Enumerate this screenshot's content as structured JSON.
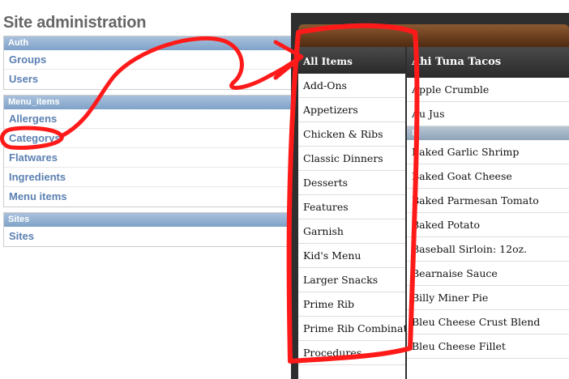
{
  "admin": {
    "title": "Site administration",
    "modules": [
      {
        "caption": "Auth",
        "rows": [
          "Groups",
          "Users"
        ]
      },
      {
        "caption": "Menu_items",
        "rows": [
          "Allergens",
          "Categorys",
          "Flatwares",
          "Ingredients",
          "Menu items"
        ]
      },
      {
        "caption": "Sites",
        "rows": [
          "Sites"
        ]
      }
    ]
  },
  "menu_app": {
    "left_header": "All Items",
    "left_items": [
      "Add-Ons",
      "Appetizers",
      "Chicken & Ribs",
      "Classic Dinners",
      "Desserts",
      "Features",
      "Garnish",
      "Kid's Menu",
      "Larger Snacks",
      "Prime Rib",
      "Prime Rib Combinations",
      "Procedures"
    ],
    "right_header": "Ahi Tuna Tacos",
    "right_items_a": [
      "Apple Crumble",
      "Au Jus"
    ],
    "right_section": "B",
    "right_items_b": [
      "Baked Garlic Shrimp",
      "Baked Goat Cheese",
      "Baked Parmesan Tomato",
      "Baked Potato",
      "Baseball Sirloin: 12oz.",
      "Bearnaise Sauce",
      "Billy Miner Pie",
      "Bleu Cheese Crust Blend",
      "Bleu Cheese Fillet"
    ]
  },
  "colors": {
    "annotation_red": "#ff1a1a",
    "admin_link": "#5b80b2",
    "admin_caption": "#7fa2c8"
  }
}
